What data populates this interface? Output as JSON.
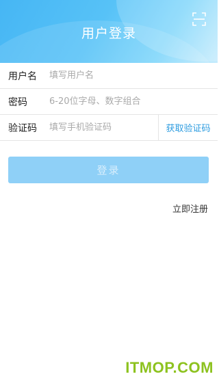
{
  "header": {
    "title": "用户登录",
    "scan_icon": "scan-icon",
    "colors": {
      "gradient_start": "#46b6f4",
      "gradient_end": "#c6ecfd"
    }
  },
  "form": {
    "username": {
      "label": "用户名",
      "placeholder": "填写用户名",
      "value": ""
    },
    "password": {
      "label": "密码",
      "placeholder": "6-20位字母、数字组合",
      "value": ""
    },
    "code": {
      "label": "验证码",
      "placeholder": "填写手机验证码",
      "value": "",
      "button_label": "获取验证码"
    }
  },
  "actions": {
    "login_label": "登录",
    "register_label": "立即注册"
  },
  "watermark": "ITMOP.COM",
  "colors": {
    "accent": "#2f9de0",
    "button_bg": "#8fd0f7",
    "watermark": "#8dc21f"
  }
}
